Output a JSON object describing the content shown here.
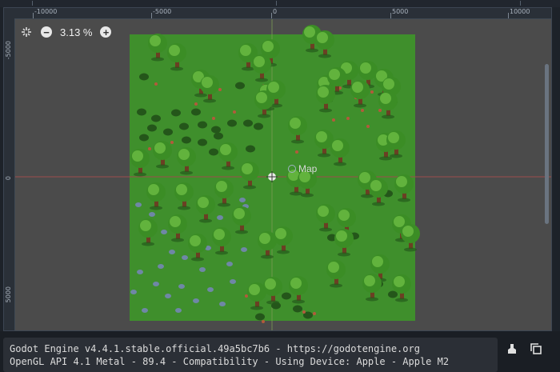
{
  "rulers": {
    "horizontal": [
      "-10000",
      "-5000",
      "0",
      "5000",
      "10000"
    ],
    "vertical": [
      "-5000",
      "0",
      "5000"
    ]
  },
  "zoom": {
    "value": "3.13 %",
    "decrease_icon": "minus-icon",
    "increase_icon": "plus-icon",
    "center_icon": "center-view-icon"
  },
  "scene": {
    "node_label": "Map",
    "node_icon": "node2d-icon"
  },
  "console": {
    "line1": "Godot Engine v4.4.1.stable.official.49a5bc7b6 - https://godotengine.org",
    "line2": "OpenGL API 4.1 Metal - 89.4 - Compatibility - Using Device: Apple - Apple M2"
  },
  "sidebar_icons": [
    "clear-output-icon",
    "copy-icon"
  ],
  "colors": {
    "grass": "#3f8f2c",
    "canvas": "#4b4b4b",
    "axis_x": "#9c4c4c",
    "axis_y": "#7c9c55"
  }
}
